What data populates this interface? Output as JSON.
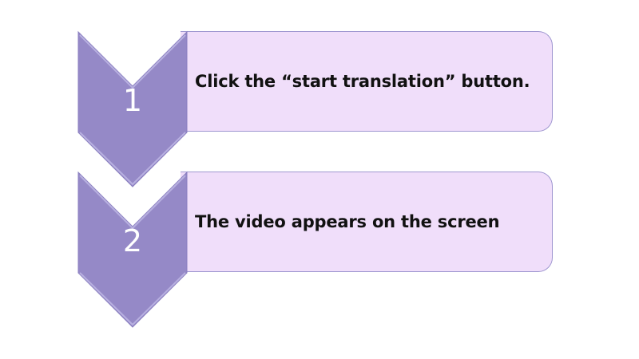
{
  "steps": [
    {
      "number": "1",
      "text": "Click the “start translation” button."
    },
    {
      "number": "2",
      "text": "The video appears on the screen"
    }
  ],
  "colors": {
    "chevron_fill": "#9589c7",
    "chevron_edge": "#b8b0e0",
    "box_fill": "#f0defa",
    "box_border": "#9f97d0"
  }
}
